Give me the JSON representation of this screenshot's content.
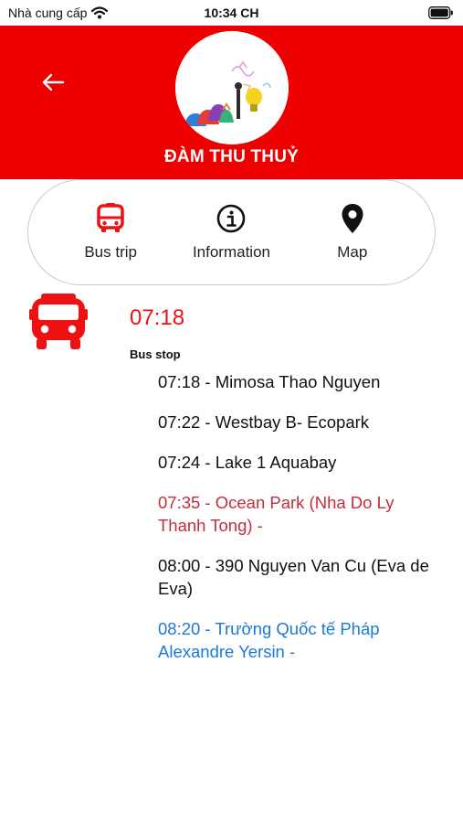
{
  "status_bar": {
    "carrier": "Nhà cung cấp",
    "time": "10:34 CH"
  },
  "header": {
    "name": "ĐÀM THU THUỶ",
    "background_color": "#ee0000"
  },
  "tabs": [
    {
      "label": "Bus trip",
      "icon": "bus-icon",
      "color": "#ee1111"
    },
    {
      "label": "Information",
      "icon": "info-icon",
      "color": "#111111"
    },
    {
      "label": "Map",
      "icon": "map-pin-icon",
      "color": "#111111"
    }
  ],
  "trip": {
    "time": "07:18",
    "bus_stop_label": "Bus stop",
    "stops": [
      {
        "text": "07:18 - Mimosa Thao Nguyen",
        "state": "default"
      },
      {
        "text": "07:22 - Westbay B- Ecopark",
        "state": "default"
      },
      {
        "text": "07:24 - Lake 1 Aquabay",
        "state": "default"
      },
      {
        "text": "07:35 - Ocean Park (Nha Do Ly Thanh Tong) -",
        "state": "past"
      },
      {
        "text": "08:00 - 390 Nguyen Van Cu (Eva de Eva)",
        "state": "default"
      },
      {
        "text": "08:20 - Trường Quốc tế Pháp Alexandre Yersin -",
        "state": "next"
      }
    ]
  },
  "colors": {
    "accent": "#ee1111",
    "past_stop": "#c62d3c",
    "next_stop": "#1a7ad6"
  }
}
